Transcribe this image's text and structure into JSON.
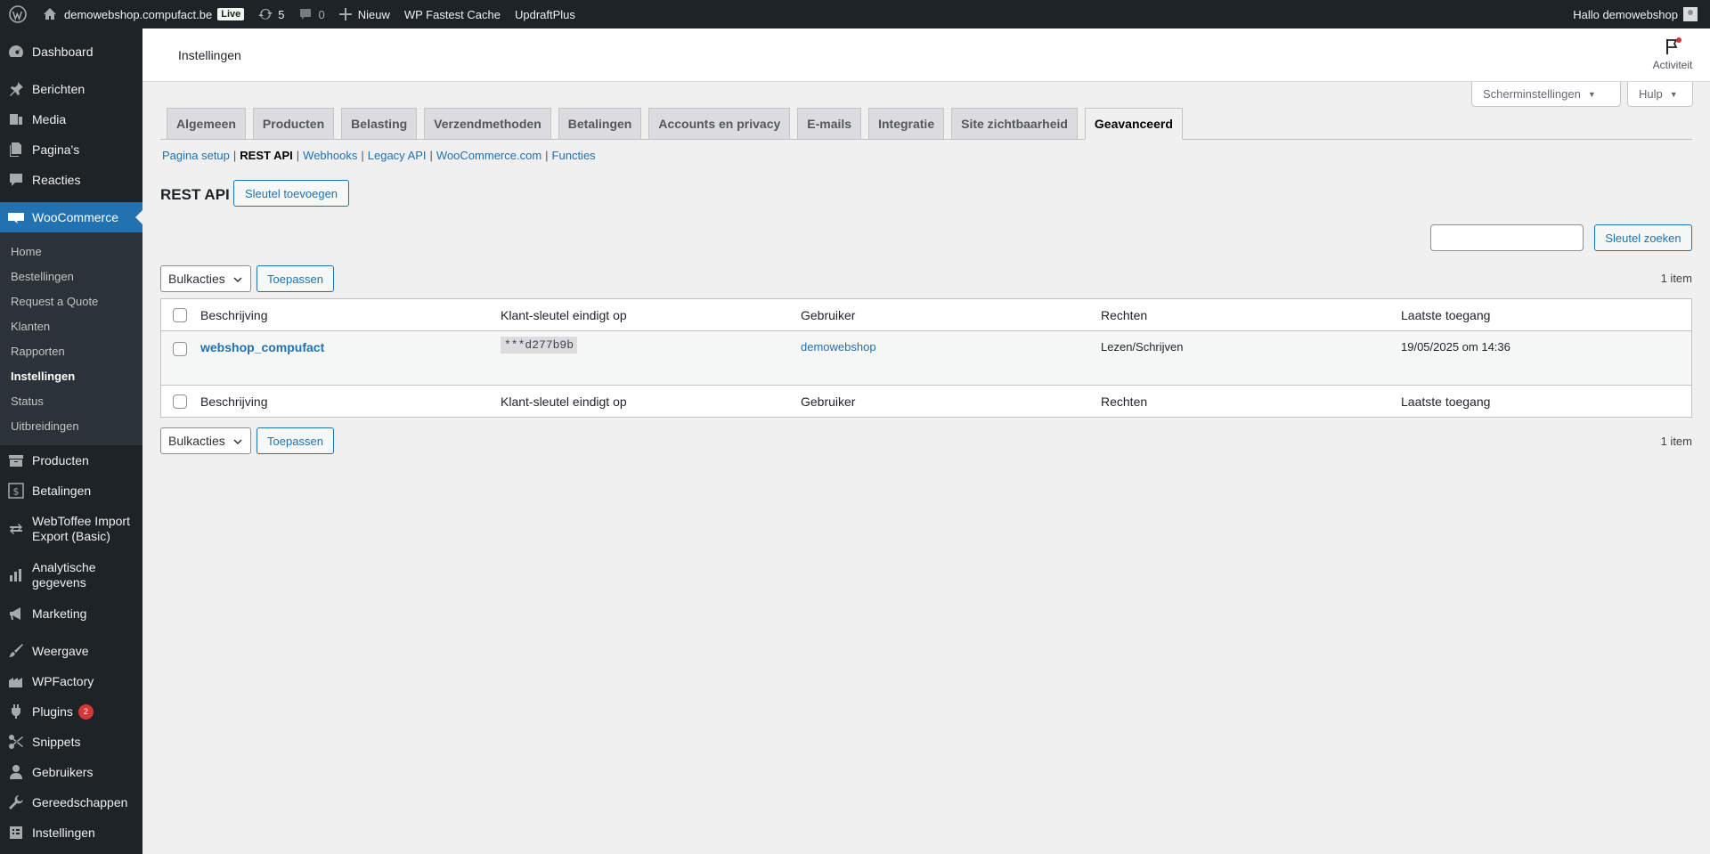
{
  "adminbar": {
    "site_name": "demowebshop.compufact.be",
    "live_label": "Live",
    "updates_count": "5",
    "comments_count": "0",
    "new_label": "Nieuw",
    "plugin1": "WP Fastest Cache",
    "plugin2": "UpdraftPlus",
    "greeting": "Hallo demowebshop"
  },
  "sidebar": {
    "dashboard": "Dashboard",
    "posts": "Berichten",
    "media": "Media",
    "pages": "Pagina's",
    "comments": "Reacties",
    "woocommerce": "WooCommerce",
    "wc_sub": [
      "Home",
      "Bestellingen",
      "Request a Quote",
      "Klanten",
      "Rapporten",
      "Instellingen",
      "Status",
      "Uitbreidingen"
    ],
    "products": "Producten",
    "payments": "Betalingen",
    "webtoffee_1": "WebToffee Import",
    "webtoffee_2": "Export (Basic)",
    "analytics_1": "Analytische",
    "analytics_2": "gegevens",
    "marketing": "Marketing",
    "appearance": "Weergave",
    "wpfactory": "WPFactory",
    "plugins": "Plugins",
    "plugins_badge": "2",
    "snippets": "Snippets",
    "users": "Gebruikers",
    "tools": "Gereedschappen",
    "settings": "Instellingen"
  },
  "header": {
    "title": "Instellingen",
    "activity": "Activiteit"
  },
  "screen_options": "Scherminstellingen",
  "help": "Hulp",
  "tabs": [
    "Algemeen",
    "Producten",
    "Belasting",
    "Verzendmethoden",
    "Betalingen",
    "Accounts en privacy",
    "E-mails",
    "Integratie",
    "Site zichtbaarheid",
    "Geavanceerd"
  ],
  "subnav": [
    "Pagina setup",
    "REST API",
    "Webhooks",
    "Legacy API",
    "WooCommerce.com",
    "Functies"
  ],
  "page": {
    "heading": "REST API",
    "add_key": "Sleutel toevoegen",
    "search_button": "Sleutel zoeken",
    "bulk_label": "Bulkacties",
    "apply": "Toepassen",
    "count": "1 item"
  },
  "table": {
    "columns": [
      "Beschrijving",
      "Klant-sleutel eindigt op",
      "Gebruiker",
      "Rechten",
      "Laatste toegang"
    ],
    "rows": [
      {
        "description": "webshop_compufact",
        "key": "***d277b9b",
        "user": "demowebshop",
        "permissions": "Lezen/Schrijven",
        "last_access": "19/05/2025 om 14:36"
      }
    ]
  }
}
